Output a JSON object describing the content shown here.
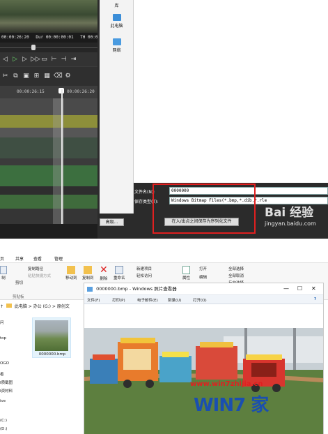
{
  "editor": {
    "timecodes": [
      "00:00:26:20",
      "Dur 00:00:00:01",
      "TH 00:0"
    ],
    "ruler": [
      "00:00:26:15",
      "00:00:26:20"
    ]
  },
  "save_dialog": {
    "nav_items": [
      "库",
      "此电脑",
      "网络"
    ],
    "filename_label": "文件名(N):",
    "filename_value": "0000000",
    "savetype_label": "保存类型(T):",
    "savetype_value": "Windows Bitmap Files(*.bmp,*.dib,*.rle",
    "advanced_button": "高级...",
    "save_serial_button": "在入/出点之间保存为序列化文件",
    "accent_color": "#e02020"
  },
  "watermark_top": {
    "logo": "Bai 经验",
    "url": "jingyan.baidu.com"
  },
  "explorer": {
    "ribbon_tabs": [
      "页",
      "共享",
      "查看",
      "管理"
    ],
    "ribbon_buttons": [
      "复制路径",
      "粘贴快捷方式",
      "剪切",
      "剪贴板",
      "移动到",
      "复制到",
      "删除",
      "重命名",
      "新建项目",
      "轻松访问",
      "属性",
      "打开",
      "编辑",
      "全部选择",
      "全部取消",
      "反向选择"
    ],
    "ribbon_left_label": "制",
    "address": [
      "此电脑",
      "办公 (G:)",
      "原创文"
    ],
    "sidebar": [
      "问",
      "top",
      "OGO",
      "者",
      "I质截图",
      "I资材料",
      "ive",
      "(C:)",
      "(D:)"
    ],
    "thumbnail_name": "0000000.bmp"
  },
  "photo_viewer": {
    "title": "0000000.bmp - Windows 照片查看器",
    "menu": [
      "文件(F)",
      "打印(P)",
      "电子邮件(E)",
      "刻录(U)",
      "打开(O)"
    ],
    "help": "?"
  },
  "watermark_bottom": {
    "url": "www.win7zhijia.cn",
    "logo": "WIN7 家"
  }
}
